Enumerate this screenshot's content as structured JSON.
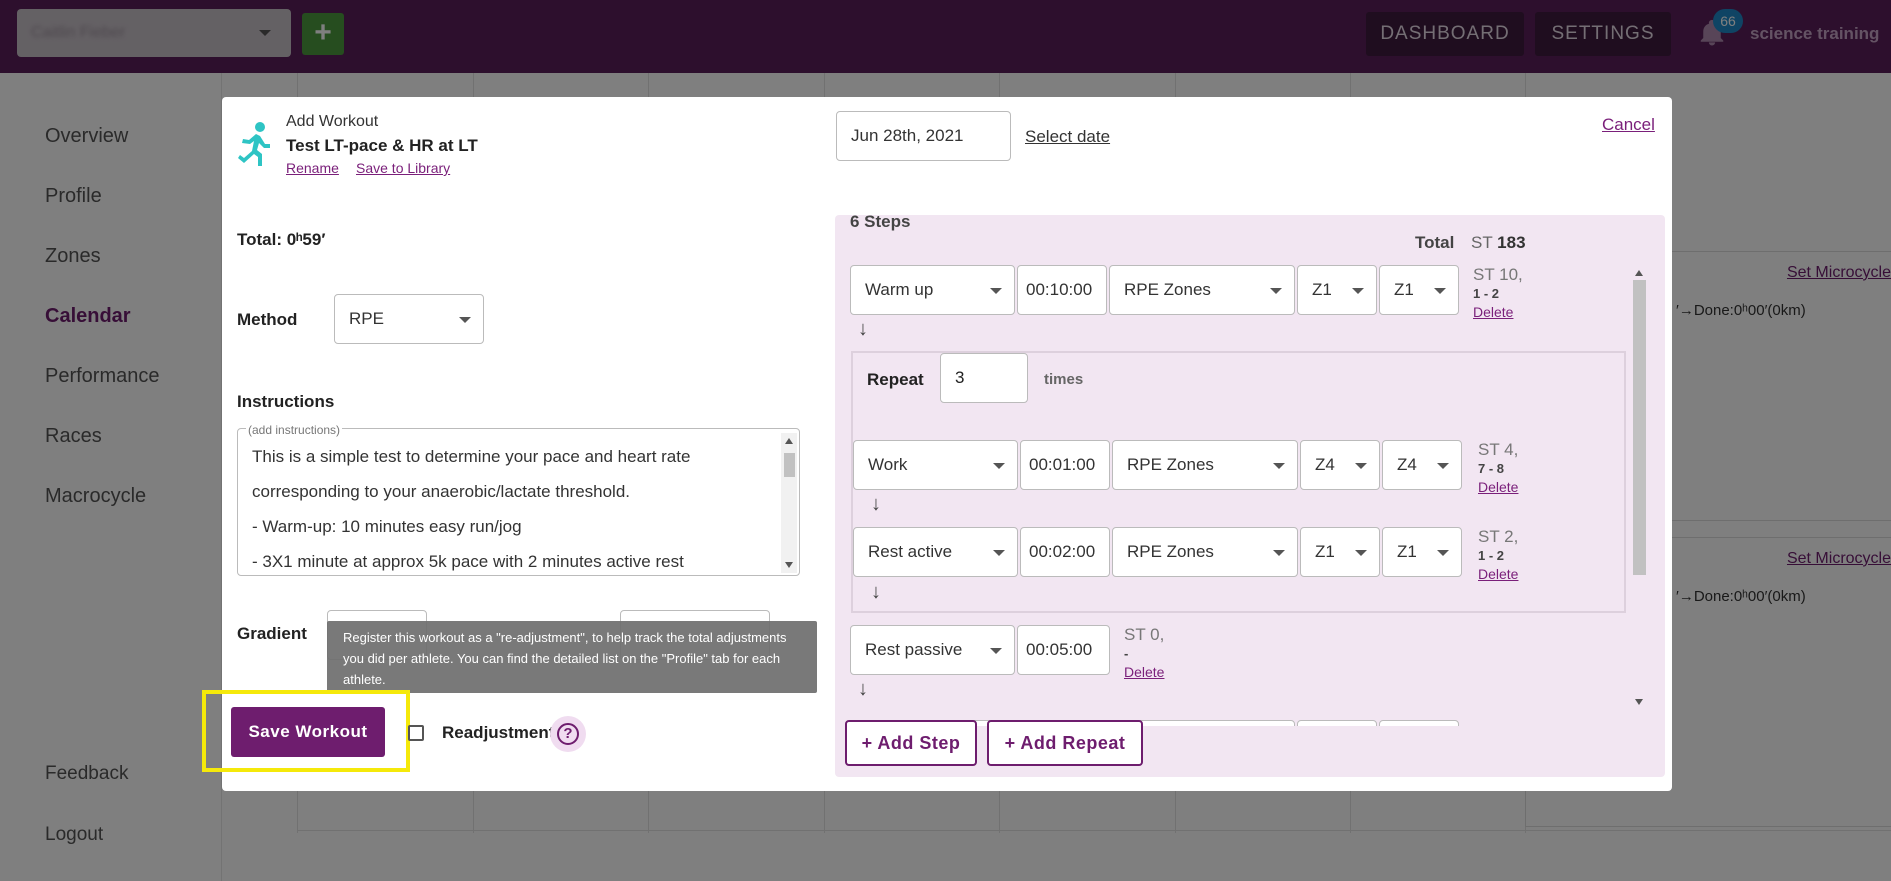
{
  "topbar": {
    "athlete_select_value": "Caitlin Fieber",
    "add_icon": "plus-icon",
    "dashboard_label": "DASHBOARD",
    "settings_label": "SETTINGS",
    "notification_count": "66",
    "team_name": "science training"
  },
  "sidebar": {
    "items": [
      {
        "label": "Overview"
      },
      {
        "label": "Profile"
      },
      {
        "label": "Zones"
      },
      {
        "label": "Calendar"
      },
      {
        "label": "Performance"
      },
      {
        "label": "Races"
      },
      {
        "label": "Macrocycle"
      }
    ],
    "feedback_label": "Feedback",
    "logout_label": "Logout"
  },
  "calendar_bg": {
    "panels": [
      {
        "link": "Set Microcycle",
        "done_text": "′→Done:0ʰ00′(0km)"
      },
      {
        "link": "Set Microcycle",
        "done_text": "′→Done:0ʰ00′(0km)"
      }
    ]
  },
  "modal": {
    "kicker": "Add Workout",
    "title": "Test LT-pace & HR at LT",
    "rename_label": "Rename",
    "save_library_label": "Save to Library",
    "date_value": "Jun 28th, 2021",
    "select_date_label": "Select date",
    "cancel_label": "Cancel",
    "total_label": "Total: 0ʰ59′",
    "method_label": "Method",
    "method_value": "RPE",
    "instructions_label": "Instructions",
    "instructions_legend": "(add instructions)",
    "instructions_lines": [
      "This is a simple test to determine your pace and heart rate",
      "corresponding to your anaerobic/lactate threshold.",
      "- Warm-up: 10 minutes easy run/jog",
      "- 3X1 minute at approx 5k pace with 2 minutes active rest"
    ],
    "gradient_label": "Gradient",
    "tooltip_text": "Register this workout as a \"re-adjustment\", to help track the total adjustments you did per athlete. You can find the detailed list on the \"Profile\" tab for each athlete.",
    "save_label": "Save Workout",
    "readjustment_label": "Readjustment",
    "help_symbol": "?"
  },
  "steps": {
    "count_label": "6 Steps",
    "total_label": "Total",
    "total_st_prefix": "ST",
    "total_st_value": "183",
    "arrow_symbol": "↓",
    "delete_label": "Delete",
    "repeat_label": "Repeat",
    "repeat_value": "3",
    "times_label": "times",
    "items": [
      {
        "type": "Warm up",
        "duration": "00:10:00",
        "zones": "RPE Zones",
        "from": "Z1",
        "to": "Z1",
        "st": "ST 10,",
        "range": "1 - 2"
      },
      {
        "type": "Work",
        "duration": "00:01:00",
        "zones": "RPE Zones",
        "from": "Z4",
        "to": "Z4",
        "st": "ST 4,",
        "range": "7 - 8"
      },
      {
        "type": "Rest active",
        "duration": "00:02:00",
        "zones": "RPE Zones",
        "from": "Z1",
        "to": "Z1",
        "st": "ST 2,",
        "range": "1 - 2"
      },
      {
        "type": "Rest passive",
        "duration": "00:05:00",
        "st": "ST 0,",
        "range": "-"
      }
    ],
    "add_step_label": "+ Add Step",
    "add_repeat_label": "+ Add Repeat"
  },
  "colors": {
    "brand_purple": "#5b1f5b",
    "accent_purple": "#6e1d6e",
    "highlight_yellow": "#f5e90a",
    "runner_teal": "#2ec4c4"
  }
}
